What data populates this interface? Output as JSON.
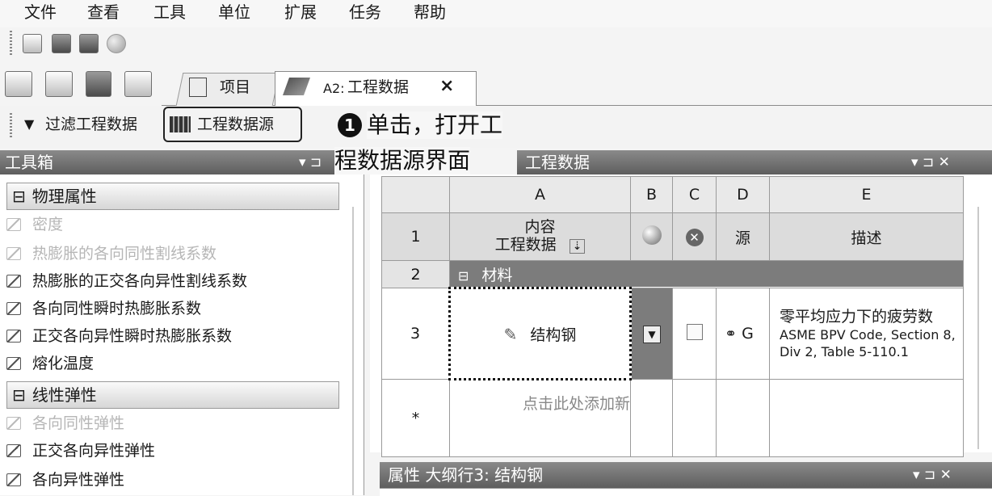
{
  "menu": [
    "文件",
    "查看",
    "工具",
    "单位",
    "扩展",
    "任务",
    "帮助"
  ],
  "tabs": {
    "project": "项目",
    "current_prefix": "A2:",
    "current": "工程数据",
    "close": "×"
  },
  "filter_bar": {
    "filter_label": "过滤工程数据",
    "source_label": "工程数据源"
  },
  "annotation": {
    "number": "1",
    "line1": "单击，打开工",
    "line2": "程数据源界面"
  },
  "toolbox": {
    "title": "工具箱",
    "pin": "▾ ⊐",
    "groups": [
      {
        "label": "物理属性",
        "items": [
          {
            "label": "密度",
            "enabled": false
          },
          {
            "label": "热膨胀的各向同性割线系数",
            "enabled": false
          },
          {
            "label": "热膨胀的正交各向异性割线系数",
            "enabled": true
          },
          {
            "label": "各向同性瞬时热膨胀系数",
            "enabled": true
          },
          {
            "label": "正交各向异性瞬时热膨胀系数",
            "enabled": true
          },
          {
            "label": "熔化温度",
            "enabled": true
          }
        ]
      },
      {
        "label": "线性弹性",
        "items": [
          {
            "label": "各向同性弹性",
            "enabled": false
          },
          {
            "label": "正交各向异性弹性",
            "enabled": true
          },
          {
            "label": "各向异性弹性",
            "enabled": true
          }
        ]
      }
    ],
    "expander": "⊟"
  },
  "engineering_data": {
    "title": "工程数据",
    "controls": "▾ ⊐ ✕",
    "columns": [
      "A",
      "B",
      "C",
      "D",
      "E"
    ],
    "rows": {
      "r1": {
        "num": "1",
        "contents": "内容\n工程数据",
        "source": "源",
        "description": "描述"
      },
      "r2": {
        "num": "2",
        "label": "材料"
      },
      "r3": {
        "num": "3",
        "material": "结构钢",
        "source_letter": "G",
        "desc_title": "零平均应力下的疲劳数",
        "desc_detail": "ASME BPV Code, Section 8, Div 2, Table 5-110.1"
      },
      "rstar": {
        "num": "*",
        "placeholder": "点击此处添加新"
      }
    }
  },
  "properties": {
    "title": "属性 大纲行3:  结构钢",
    "controls": "▾ ⊐ ✕"
  }
}
